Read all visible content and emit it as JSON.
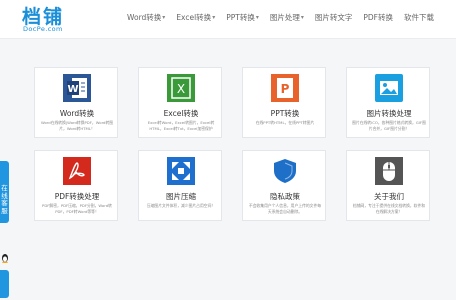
{
  "header": {
    "logo_main": "档铺",
    "logo_sub": "DocPe.com",
    "nav": [
      {
        "label": "Word转换",
        "dropdown": true
      },
      {
        "label": "Excel转换",
        "dropdown": true
      },
      {
        "label": "PPT转换",
        "dropdown": true
      },
      {
        "label": "图片处理",
        "dropdown": true
      },
      {
        "label": "图片转文字",
        "dropdown": false
      },
      {
        "label": "PDF转换",
        "dropdown": false
      },
      {
        "label": "软件下载",
        "dropdown": false
      }
    ]
  },
  "cards": [
    {
      "title": "Word转换",
      "desc": "Word在线转换|Word转换PDF，Word转图片，Word转HTML！",
      "icon": "word-icon",
      "color": "#2b5797"
    },
    {
      "title": "Excel转换",
      "desc": "Excel转Word，Excel转图片，Excel转HTML，Excel转Txt，Excel加密保护",
      "icon": "excel-icon",
      "color": "#3a9a3a"
    },
    {
      "title": "PPT转换",
      "desc": "在线PPT转HTML，在线PPT转图片",
      "icon": "ppt-icon",
      "color": "#e8632b"
    },
    {
      "title": "图片转换处理",
      "desc": "图片在线转ICO，各种图片格式转换，GIF图片合并，GIF图片分割！",
      "icon": "image-icon",
      "color": "#1aa0e0"
    },
    {
      "title": "PDF转换处理",
      "desc": "PDF解密，PDF压缩，PDF分割，Word转PDF，PDF转Word等等！",
      "icon": "pdf-icon",
      "color": "#d42a1e"
    },
    {
      "title": "图片压缩",
      "desc": "压缩图片文件体积，减少图片占用空间！",
      "icon": "compress-icon",
      "color": "#1f6fcf"
    },
    {
      "title": "隐私政策",
      "desc": "不会收集用户个人信息，用户上传的文件每天系统会自动删除。",
      "icon": "shield-icon",
      "color": "#1e6fc8"
    },
    {
      "title": "关于我们",
      "desc": "档铺网，专注于提供在线文档转换，软件和在线解决方案！",
      "icon": "mouse-icon",
      "color": "#555555"
    }
  ],
  "sidebar": {
    "tab_label": "在线客服"
  }
}
